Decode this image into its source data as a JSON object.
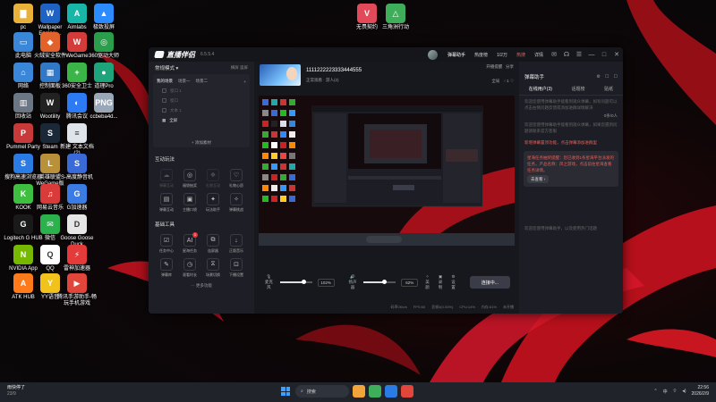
{
  "desktop_icons": [
    {
      "label": "pc",
      "glyph": "▇",
      "color": "#e8b23a"
    },
    {
      "label": "Wallpaper Engine:...",
      "glyph": "W",
      "color": "#1e63c4"
    },
    {
      "label": "Aimlabs",
      "glyph": "A",
      "color": "#17b6a8"
    },
    {
      "label": "极致投屏",
      "glyph": "▲",
      "color": "#2b8cff"
    },
    {
      "label": "此电脑",
      "glyph": "▭",
      "color": "#3a86d8"
    },
    {
      "label": "火绒安全软件",
      "glyph": "◆",
      "color": "#e2622b"
    },
    {
      "label": "WeGame",
      "glyph": "W",
      "color": "#d43b3b"
    },
    {
      "label": "360驱动大师",
      "glyph": "◎",
      "color": "#2a9e4b"
    },
    {
      "label": "网络",
      "glyph": "⌂",
      "color": "#3a86d8"
    },
    {
      "label": "控制面板",
      "glyph": "▦",
      "color": "#3178c6"
    },
    {
      "label": "360安全卫士",
      "glyph": "+",
      "color": "#3bb548"
    },
    {
      "label": "道理Pro",
      "glyph": "●",
      "color": "#1ea47a"
    },
    {
      "label": "回收站",
      "glyph": "▥",
      "color": "#6b7784"
    },
    {
      "label": "Wootility",
      "glyph": "W",
      "color": "#222"
    },
    {
      "label": "腾讯会议",
      "glyph": "◐",
      "color": "#2d7bf4"
    },
    {
      "label": "ccbeba4d...",
      "glyph": "PNG",
      "color": "#9aa7b6"
    },
    {
      "label": "Pummel Party",
      "glyph": "P",
      "color": "#c83a3a"
    },
    {
      "label": "Steam",
      "glyph": "S",
      "color": "#1b2838"
    },
    {
      "label": "新建 文本文档 (2)",
      "glyph": "≡",
      "color": "#dfe4ea"
    },
    {
      "label": "搜狗高速浏览器",
      "glyph": "S",
      "color": "#2b7be4"
    },
    {
      "label": "英雄联盟WeGame版",
      "glyph": "L",
      "color": "#b8913a"
    },
    {
      "label": "S-高度静音机",
      "glyph": "S",
      "color": "#3a6ad8"
    },
    {
      "label": "KOOK",
      "glyph": "K",
      "color": "#3fbf3f"
    },
    {
      "label": "网易云音乐",
      "glyph": "♫",
      "color": "#d93a3a"
    },
    {
      "label": "G加速器",
      "glyph": "G",
      "color": "#3a7be4"
    },
    {
      "label": "Logitech G HUB",
      "glyph": "G",
      "color": "#1a1a1a"
    },
    {
      "label": "微信",
      "glyph": "✉",
      "color": "#2bb24c"
    },
    {
      "label": "Goose Goose Duck",
      "glyph": "D",
      "color": "#e6e6e6"
    },
    {
      "label": "NVIDIA App",
      "glyph": "N",
      "color": "#76b900"
    },
    {
      "label": "QQ",
      "glyph": "Q",
      "color": "#ffffff"
    },
    {
      "label": "雷神加速器",
      "glyph": "⚡",
      "color": "#e43a3a"
    },
    {
      "label": "ATK HUB",
      "glyph": "A",
      "color": "#ff7a1a"
    },
    {
      "label": "YY语音",
      "glyph": "Y",
      "color": "#f2c21c"
    },
    {
      "label": "腾讯手游助手-畅玩手机游戏",
      "glyph": "▶",
      "color": "#e2453a"
    },
    {
      "label": "无畏契约",
      "glyph": "V",
      "color": "#e24a5a"
    },
    {
      "label": "三角洲行动",
      "glyph": "△",
      "color": "#3fae5a"
    }
  ],
  "app": {
    "logo": "直播伴侣",
    "version": "6.5.5.4",
    "title_controls": [
      "✉",
      "☊",
      "☰",
      "—",
      "□",
      "✕"
    ],
    "stream_tag": "弹幕助手",
    "top_metrics": [
      "热度榜",
      "1/2万",
      "热搜",
      "详情"
    ],
    "left": {
      "mode": "常规模式 ▾",
      "mode_actions": [
        "横屏",
        "竖屏"
      ],
      "scene_title": "我的场景",
      "scene_tabs": [
        "场景一",
        "场景二",
        "场景三"
      ],
      "sources": [
        "窗口 1",
        "窗口",
        "文本 1",
        "全屏"
      ],
      "add_material": "+ 添加素材",
      "interact_title": "互动玩法",
      "interact_tools": [
        {
          "label": "弹幕互动",
          "glyph": "☁",
          "dim": true
        },
        {
          "label": "福袋抽奖",
          "glyph": "◎",
          "dim": false
        },
        {
          "label": "礼物互动",
          "glyph": "❖",
          "dim": true
        },
        {
          "label": "礼物心愿",
          "glyph": "♡",
          "dim": false
        },
        {
          "label": "弹幕互动",
          "glyph": "▤",
          "dim": false
        },
        {
          "label": "主播口袋",
          "glyph": "▣",
          "dim": false
        },
        {
          "label": "玩法助手",
          "glyph": "✦",
          "dim": false
        },
        {
          "label": "弹幕挑战",
          "glyph": "✧",
          "dim": false
        }
      ],
      "base_title": "基础工具",
      "base_tools": [
        {
          "label": "任务中心",
          "glyph": "☑",
          "badge": ""
        },
        {
          "label": "星海任务",
          "glyph": "AI",
          "badge": "1"
        },
        {
          "label": "连屏器",
          "glyph": "⧉",
          "badge": ""
        },
        {
          "label": "正版音乐",
          "glyph": "↓",
          "badge": ""
        },
        {
          "label": "弹幕库",
          "glyph": "✎",
          "badge": ""
        },
        {
          "label": "观看时长",
          "glyph": "◷",
          "badge": ""
        },
        {
          "label": "场景切换",
          "glyph": "⧖",
          "badge": ""
        },
        {
          "label": "下播设置",
          "glyph": "⊡",
          "badge": ""
        }
      ],
      "more": "··· 更多功能"
    },
    "center": {
      "room_title": "1111222223333444555",
      "room_sub": "正常观看 · 游人(2)",
      "room_right_top": "开播提醒",
      "room_right_top2": "分享",
      "room_right_bottom": "全局",
      "likes": "1",
      "mic_label": "麦克风",
      "mic_pct": "102%",
      "mic_level": 0.72,
      "spk_label": "扬声器",
      "spk_pct": "62%",
      "spk_level": 0.62,
      "tools": [
        "美颜",
        "录制",
        "设置"
      ],
      "connect": "连接中...",
      "stats": [
        "码率0Kb/s",
        "FPS:60",
        "丢帧0(0.00%)",
        "CPU:14%",
        "内存:61%",
        "未开播"
      ]
    },
    "right": {
      "title": "弹幕助手",
      "head_icons": [
        "⚙",
        "☐",
        "☐"
      ],
      "tabs": [
        "在线用户(3)",
        "话题榜",
        "贴纸"
      ],
      "messages": [
        {
          "text": "欢迎您使用弹幕助手能看到观众弹幕，如有问题可以点击右侧问题反馈或添加进群详情解决",
          "hi": false
        },
        {
          "text": "欢迎您使用弹幕助手能看到观众弹幕，如果您遇到问题请联系官方客服",
          "hi": false
        },
        {
          "text": "新增弹幕置顶功能，点击弹幕添加进群里",
          "hi": true
        }
      ],
      "count": "0条/0人",
      "notice": "星海任务抽奖提醒：您已收到1条星海平台派发的任务，产品名称：风之游戏，点击前往星海查看任务详情。",
      "notice_go": "去查看 ›",
      "footer_msg": "欢迎您使用弹幕助手，以及使用热门话题"
    }
  },
  "taskbar": {
    "weather_title": "雨快停了",
    "weather_sub": "23/9",
    "search": "搜索",
    "app_colors": [
      "#f0a43a",
      "#3fae5a",
      "#2b7be4",
      "#e2453a"
    ],
    "time": "22:56",
    "date": "2026/2/9",
    "tray": "中"
  }
}
